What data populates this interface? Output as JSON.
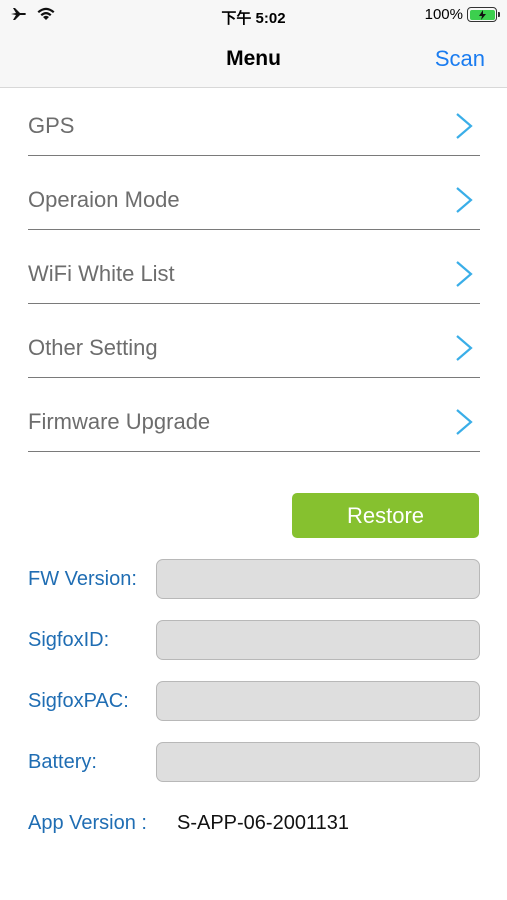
{
  "status_bar": {
    "time": "下午 5:02",
    "battery_percent": "100%",
    "battery_level": 1.0,
    "icons": [
      "airplane-icon",
      "wifi-icon",
      "battery-charging-icon"
    ]
  },
  "nav": {
    "title": "Menu",
    "scan_label": "Scan"
  },
  "menu": {
    "items": [
      {
        "label": "GPS"
      },
      {
        "label": "Operaion Mode"
      },
      {
        "label": "WiFi White List"
      },
      {
        "label": "Other Setting"
      },
      {
        "label": "Firmware Upgrade"
      }
    ]
  },
  "restore_label": "Restore",
  "info": {
    "fw_version": {
      "label": "FW Version:",
      "value": ""
    },
    "sigfox_id": {
      "label": "SigfoxID:",
      "value": ""
    },
    "sigfox_pac": {
      "label": "SigfoxPAC:",
      "value": ""
    },
    "battery": {
      "label": "Battery:",
      "value": ""
    }
  },
  "app_version": {
    "label": "App Version :",
    "value": "S-APP-06-2001131"
  },
  "colors": {
    "accent_blue": "#1a7cf0",
    "label_blue": "#1f6db3",
    "chevron_blue": "#3aaee8",
    "restore_green": "#86c12f",
    "battery_green": "#3ccf4e"
  }
}
